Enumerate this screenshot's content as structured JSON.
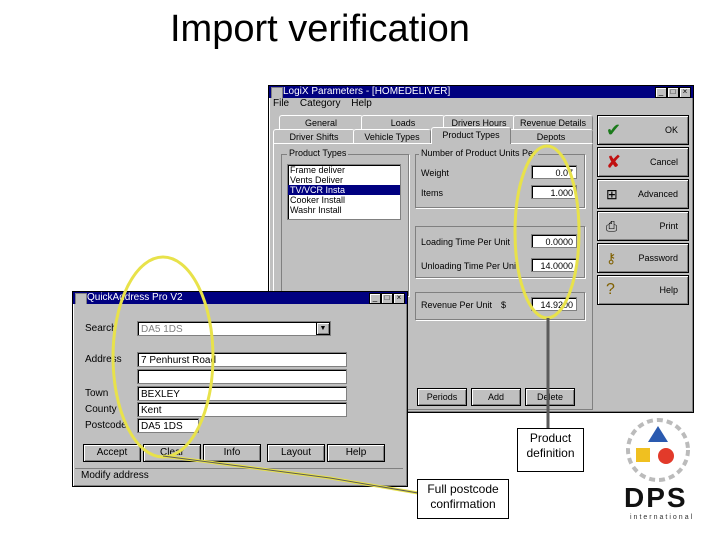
{
  "slide": {
    "title": "Import verification"
  },
  "parameters_window": {
    "title": "LogiX Parameters - [HOMEDELIVER]",
    "menu": [
      "File",
      "Category",
      "Help"
    ],
    "tabs_row1": [
      "General",
      "Loads",
      "Drivers Hours",
      "Revenue Details"
    ],
    "tabs_row2": [
      "Driver Shifts",
      "Vehicle Types",
      "Product Types",
      "Depots"
    ],
    "product_types": {
      "label": "Product Types",
      "items": [
        "Frame deliver",
        "Vents Deliver",
        "TV/VCR Insta",
        "Cooker Install",
        "Washr Install"
      ],
      "selected_index": 2
    },
    "units": {
      "label": "Number of Product Units Per",
      "weight_label": "Weight",
      "weight_value": "0.07",
      "items_label": "Items",
      "items_value": "1.000"
    },
    "timing": {
      "loading_label": "Loading Time Per Unit",
      "loading_value": "0.0000",
      "unloading_label": "Unloading Time Per Unit",
      "unloading_value": "14.0000"
    },
    "revenue": {
      "label": "Revenue Per Unit",
      "currency": "$",
      "value": "14.9200"
    },
    "bottom_buttons": [
      "Periods",
      "Add",
      "Delete"
    ],
    "side_buttons": [
      {
        "label": "OK",
        "icon": "checkmark-icon"
      },
      {
        "label": "Cancel",
        "icon": "cross-icon"
      },
      {
        "label": "Advanced",
        "icon": "hierarchy-icon"
      },
      {
        "label": "Print",
        "icon": "printer-icon"
      },
      {
        "label": "Password",
        "icon": "key-icon"
      },
      {
        "label": "Help",
        "icon": "question-icon"
      }
    ]
  },
  "quickaddress_window": {
    "title": "QuickAddress Pro V2",
    "search_label": "Search",
    "search_value": "DA5 1DS",
    "address_label": "Address",
    "address_lines": [
      "7 Penhurst Road",
      "",
      ""
    ],
    "town_label": "Town",
    "town_value": "BEXLEY",
    "county_label": "County",
    "county_value": "Kent",
    "postcode_label": "Postcode",
    "postcode_value": "DA5 1DS",
    "buttons": [
      "Accept",
      "Clear",
      "Info",
      "Layout",
      "Help"
    ],
    "status": "Modify address"
  },
  "callouts": {
    "product": "Product definition",
    "postcode": "Full postcode confirmation"
  },
  "logo": {
    "text": "DPS",
    "subtext": "international"
  },
  "colors": {
    "titlebar": "#000080",
    "highlight": "#e8e24a",
    "logo_red": "#e23a2a",
    "logo_blue": "#2a5ab0",
    "logo_yellow": "#f0c020"
  }
}
